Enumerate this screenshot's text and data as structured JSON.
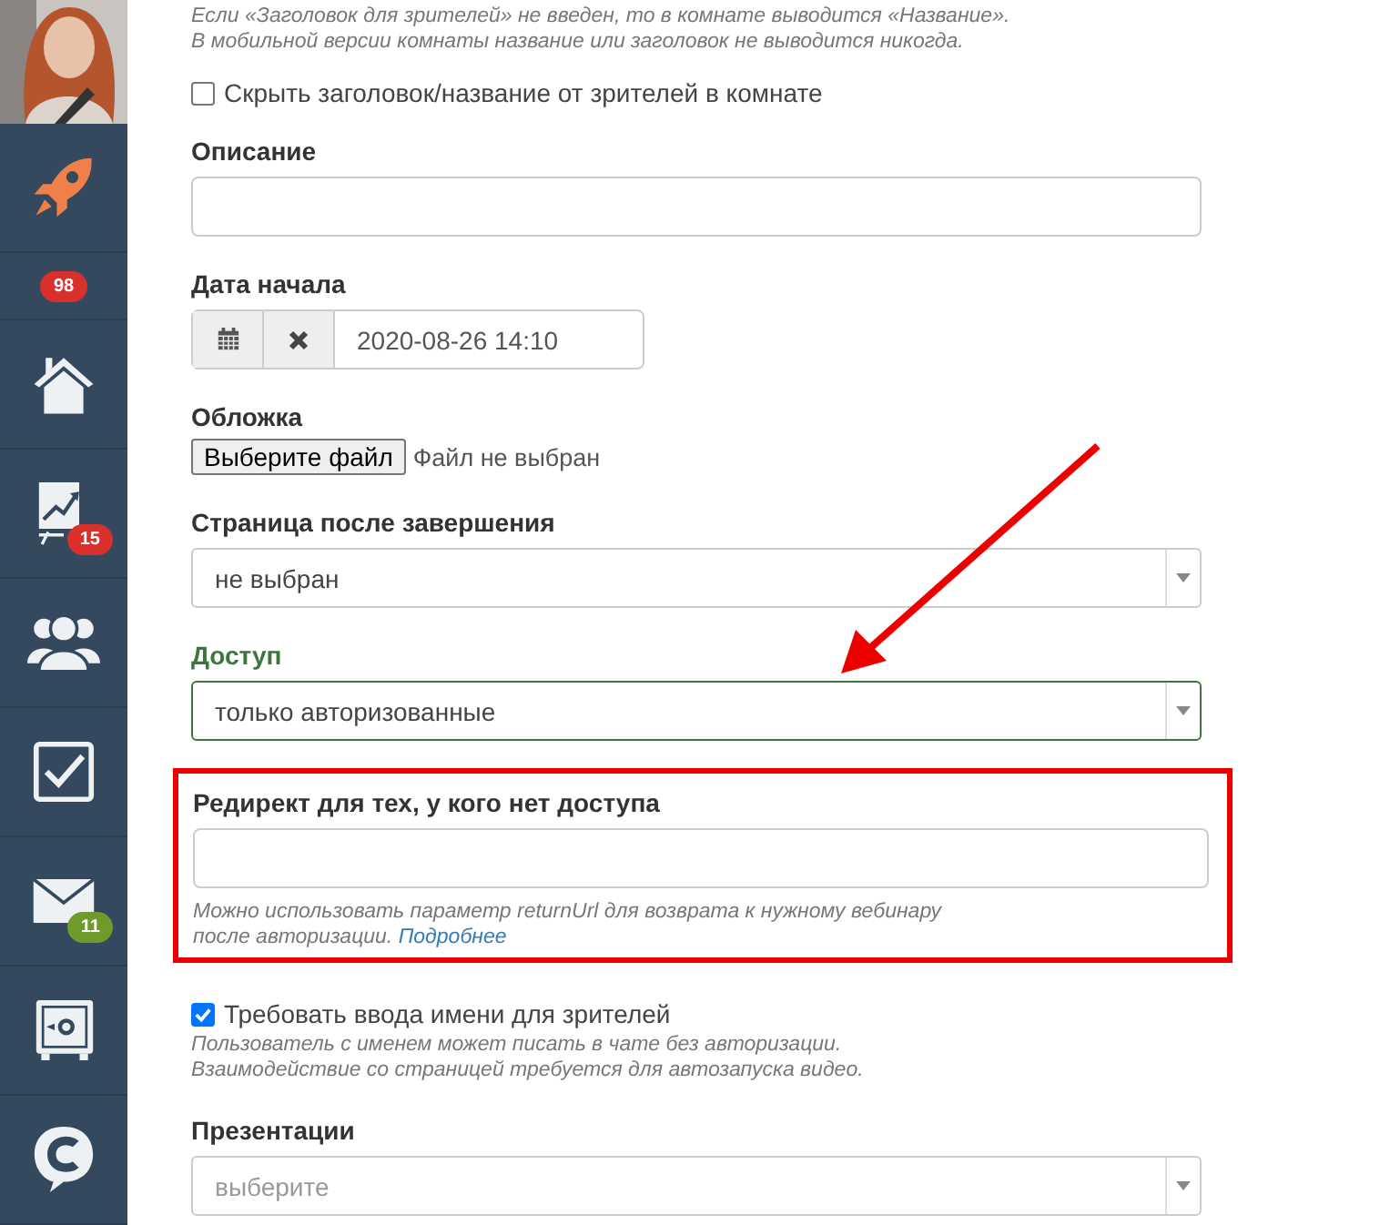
{
  "sidebar": {
    "items": [
      {
        "kind": "rocket"
      },
      {
        "kind": "badge",
        "badge": "98",
        "color": "#d9302c"
      },
      {
        "kind": "home"
      },
      {
        "kind": "chart",
        "badge": "15",
        "color": "#d9302c"
      },
      {
        "kind": "users"
      },
      {
        "kind": "tasks"
      },
      {
        "kind": "mail",
        "badge": "11",
        "color": "#6f9a2c"
      },
      {
        "kind": "safe"
      },
      {
        "kind": "chat"
      }
    ]
  },
  "notes": "Если «Заголовок для зрителей» не введен, то в комнате выводится «Название».\nВ мобильной версии комнаты название или заголовок не выводится никогда.",
  "hide_title": {
    "label": "Скрыть заголовок/название от зрителей в комнате",
    "checked": false
  },
  "fields": [
    {
      "kind": "text",
      "label": "Описание"
    },
    {
      "kind": "date",
      "label": "Дата начала",
      "value": "2020-08-26 14:10"
    },
    {
      "kind": "file",
      "label": "Обложка",
      "button": "Выберите файл",
      "status": "Файл не выбран"
    },
    {
      "kind": "select",
      "label": "Страница после завершения",
      "value": "не выбран",
      "valid": false
    },
    {
      "kind": "select",
      "label": "Доступ",
      "value": "только авторизованные",
      "valid": true
    },
    {
      "kind": "text",
      "label": "Редирект для тех, у кого нет доступа",
      "highlighted": true,
      "help": "Можно использовать параметр returnUrl для возврата к нужному вебинару\nпосле авторизации. ",
      "link": "Подробнее"
    },
    {
      "kind": "checkbox",
      "label": "Требовать ввода имени для зрителей",
      "checked": true,
      "help": "Пользователь с именем может писать в чате без авторизации.\nВзаимодействие со страницей требуется для автозапуска видео."
    },
    {
      "kind": "select",
      "label": "Презентации",
      "placeholder": "выберите",
      "valid": false
    }
  ]
}
